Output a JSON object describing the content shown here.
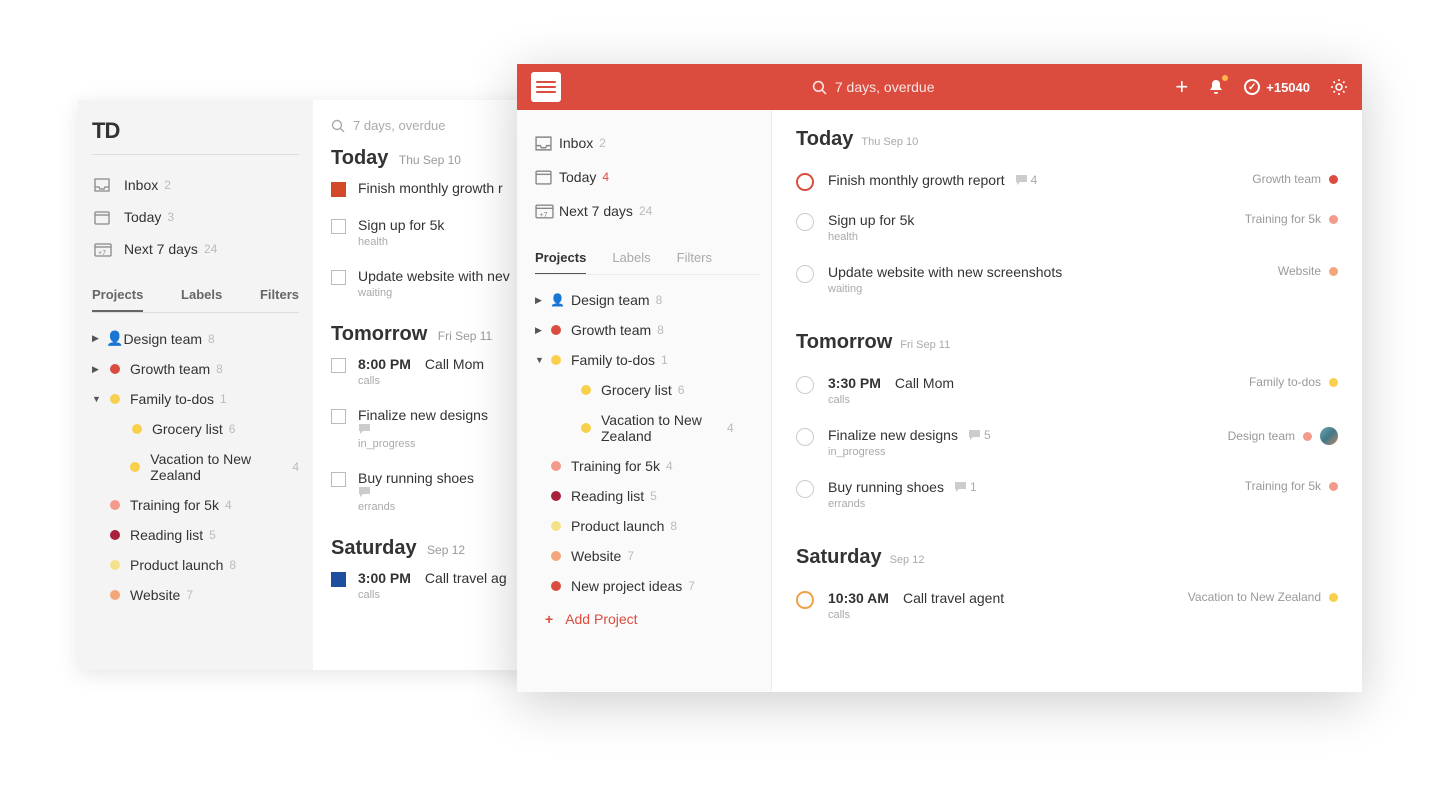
{
  "colors": {
    "accent": "#db4c3f",
    "orange": "#f5a623",
    "yellow": "#f8d04b",
    "pink": "#f39a8b",
    "maroon": "#a8203a",
    "paleyellow": "#f4e28a",
    "peach": "#f3a67a",
    "red": "#db4c3f",
    "blue": "#1e4f9e",
    "grey": "#c8c8c8"
  },
  "back": {
    "logo_text": "TD",
    "search_placeholder": "7 days, overdue",
    "nav": {
      "inbox": {
        "label": "Inbox",
        "count": "2"
      },
      "today": {
        "label": "Today",
        "count": "3"
      },
      "next7": {
        "label": "Next 7 days",
        "count": "24"
      }
    },
    "tabs": {
      "projects": "Projects",
      "labels": "Labels",
      "filters": "Filters"
    },
    "projects": [
      {
        "arrow": "▶",
        "dot_key": "personic",
        "label": "Design team",
        "count": "8"
      },
      {
        "arrow": "▶",
        "dot": "#db4c3f",
        "label": "Growth team",
        "count": "8"
      },
      {
        "arrow": "▼",
        "dot": "#f8d04b",
        "label": "Family to-dos",
        "count": "1"
      },
      {
        "sub": true,
        "dot": "#f8d04b",
        "label": "Grocery list",
        "count": "6"
      },
      {
        "sub": true,
        "dot": "#f8d04b",
        "label": "Vacation to New Zealand",
        "count": "4"
      },
      {
        "dot": "#f39a8b",
        "label": "Training for 5k",
        "count": "4"
      },
      {
        "dot": "#a8203a",
        "label": "Reading list",
        "count": "5"
      },
      {
        "dot": "#f4e28a",
        "label": "Product launch",
        "count": "8"
      },
      {
        "dot": "#f3a67a",
        "label": "Website",
        "count": "7"
      }
    ],
    "sections": [
      {
        "title": "Today",
        "date": "Thu Sep 10",
        "tasks": [
          {
            "chk": "filled",
            "text": "Finish monthly growth r"
          },
          {
            "text": "Sign up for 5k",
            "meta": "health"
          },
          {
            "text": "Update website with nev",
            "meta": "waiting"
          }
        ]
      },
      {
        "title": "Tomorrow",
        "date": "Fri Sep 11",
        "tasks": [
          {
            "time": "8:00 PM",
            "text": "Call Mom",
            "meta": "calls"
          },
          {
            "text": "Finalize new designs",
            "meta": "in_progress",
            "hasComment": true
          },
          {
            "text": "Buy running shoes",
            "meta": "errands",
            "hasComment": true
          }
        ]
      },
      {
        "title": "Saturday",
        "date": "Sep 12",
        "tasks": [
          {
            "chk": "filledblue",
            "time": "3:00 PM",
            "text": "Call travel ag",
            "meta": "calls"
          }
        ]
      }
    ]
  },
  "front": {
    "search_placeholder": "7 days, overdue",
    "karma": "+15040",
    "nav": {
      "inbox": {
        "label": "Inbox",
        "count": "2"
      },
      "today": {
        "label": "Today",
        "count": "4",
        "red": true
      },
      "next7": {
        "label": "Next 7 days",
        "count": "24"
      }
    },
    "tabs": {
      "projects": "Projects",
      "labels": "Labels",
      "filters": "Filters"
    },
    "projects": [
      {
        "arrow": "▶",
        "personic": true,
        "label": "Design team",
        "count": "8"
      },
      {
        "arrow": "▶",
        "dot": "#db4c3f",
        "label": "Growth team",
        "count": "8"
      },
      {
        "arrow": "▼",
        "dot": "#f8d04b",
        "label": "Family to-dos",
        "count": "1"
      },
      {
        "sub": true,
        "dot": "#f8d04b",
        "label": "Grocery list",
        "count": "6"
      },
      {
        "sub": true,
        "wrap": true,
        "dot": "#f8d04b",
        "label": "Vacation to New Zealand",
        "count": "4"
      },
      {
        "dot": "#f39a8b",
        "label": "Training for 5k",
        "count": "4"
      },
      {
        "dot": "#a8203a",
        "label": "Reading list",
        "count": "5"
      },
      {
        "dot": "#f4e28a",
        "label": "Product launch",
        "count": "8"
      },
      {
        "dot": "#f3a67a",
        "label": "Website",
        "count": "7"
      },
      {
        "dot": "#db4c3f",
        "label": "New project ideas",
        "count": "7"
      }
    ],
    "add_project": "Add Project",
    "sections": [
      {
        "title": "Today",
        "date": "Thu Sep 10",
        "tasks": [
          {
            "priority": "p1",
            "text": "Finish monthly growth report",
            "comments": "4",
            "project": "Growth team",
            "pdot": "#db4c3f"
          },
          {
            "text": "Sign up for 5k",
            "meta": "health",
            "project": "Training for 5k",
            "pdot": "#f39a8b"
          },
          {
            "text": "Update website with new screenshots",
            "meta": "waiting",
            "project": "Website",
            "pdot": "#f3a67a"
          }
        ]
      },
      {
        "title": "Tomorrow",
        "date": "Fri Sep 11",
        "tasks": [
          {
            "time": "3:30 PM",
            "text": "Call Mom",
            "meta": "calls",
            "project": "Family to-dos",
            "pdot": "#f8d04b"
          },
          {
            "text": "Finalize new designs",
            "comments": "5",
            "meta": "in_progress",
            "project": "Design team",
            "pdot": "#f39a8b",
            "avatar": true
          },
          {
            "text": "Buy running shoes",
            "comments": "1",
            "meta": "errands",
            "project": "Training for 5k",
            "pdot": "#f39a8b"
          }
        ]
      },
      {
        "title": "Saturday",
        "date": "Sep 12",
        "tasks": [
          {
            "priority": "p2",
            "time": "10:30 AM",
            "text": "Call travel agent",
            "meta": "calls",
            "project": "Vacation to New Zealand",
            "pdot": "#f8d04b"
          }
        ]
      }
    ]
  }
}
